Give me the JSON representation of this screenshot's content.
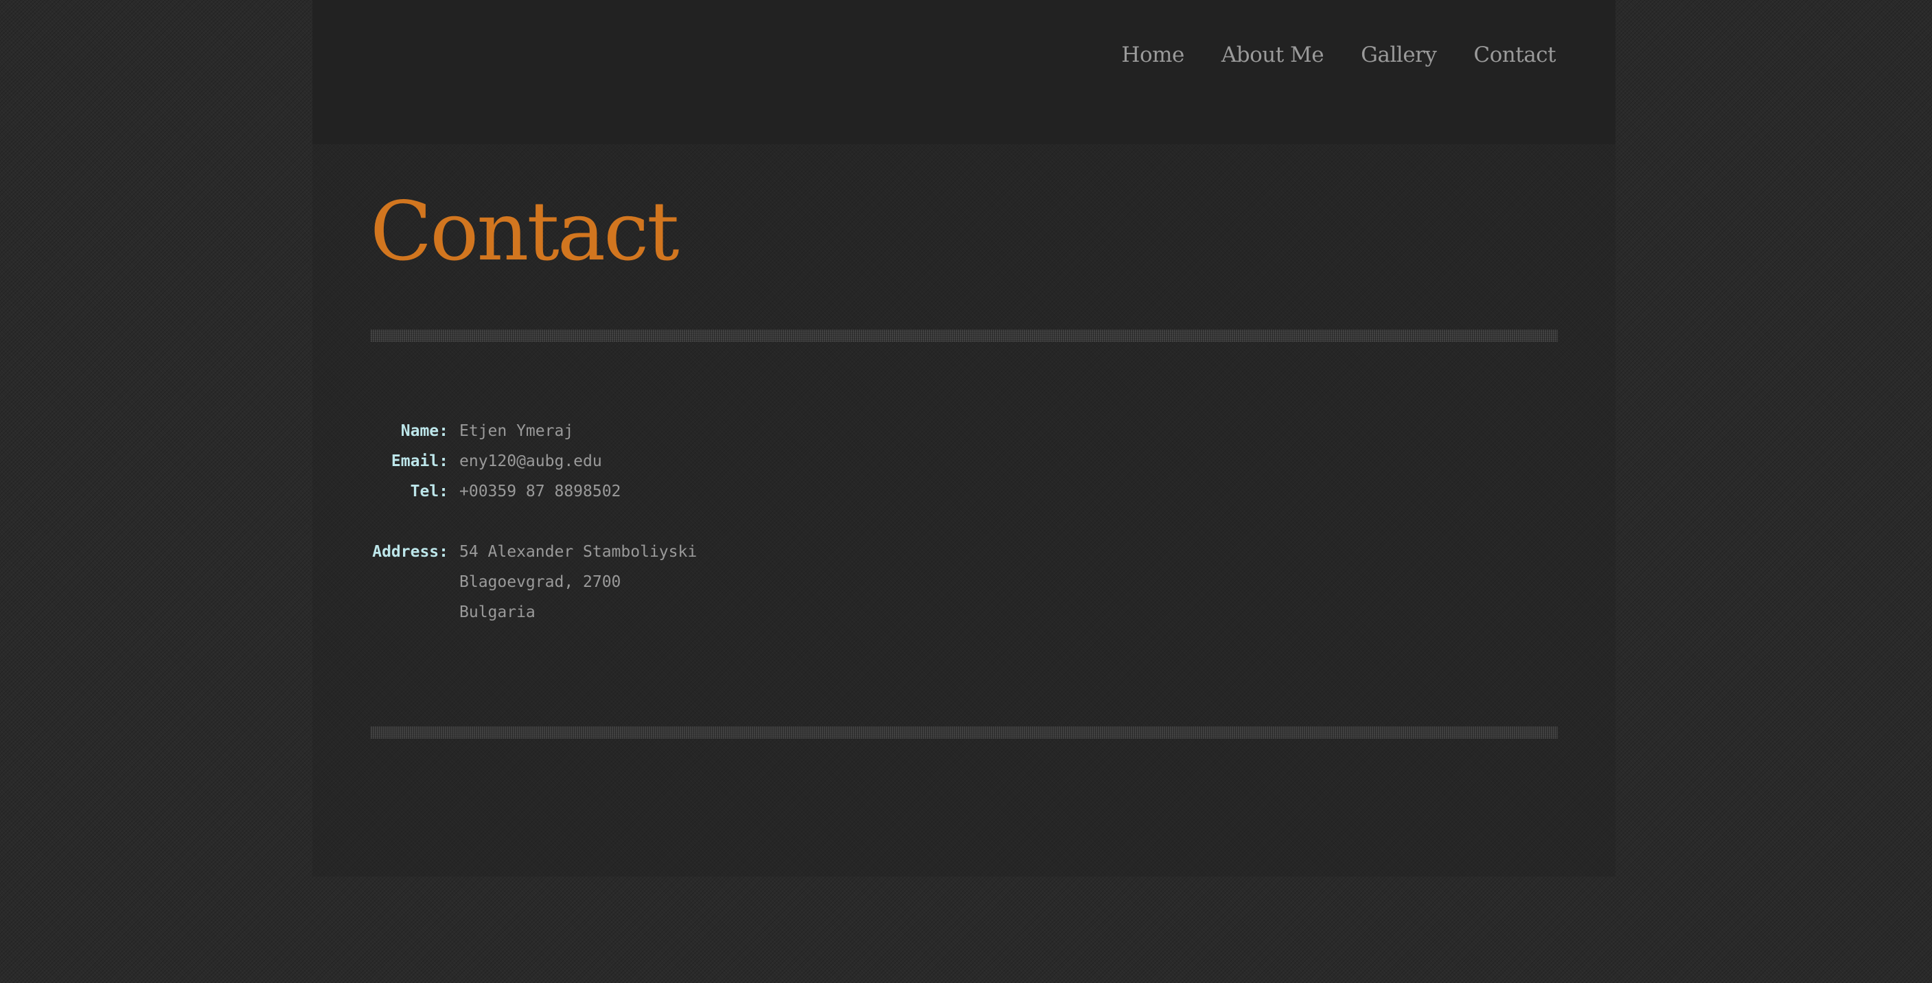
{
  "nav": {
    "items": [
      "Home",
      "About Me",
      "Gallery",
      "Contact"
    ]
  },
  "page": {
    "title": "Contact"
  },
  "contact": {
    "name_label": "Name:",
    "name": "Etjen Ymeraj",
    "email_label": "Email:",
    "email": "eny120@aubg.edu",
    "tel_label": "Tel:",
    "tel": "+00359 87 8898502",
    "address_label": "Address:",
    "address_lines": [
      "54 Alexander Stamboliyski",
      "Blagoevgrad, 2700",
      "Bulgaria"
    ]
  },
  "colors": {
    "accent": "#d2761f",
    "label": "#bde6ea",
    "text": "#9a9a9a",
    "header_bg": "#222222"
  }
}
